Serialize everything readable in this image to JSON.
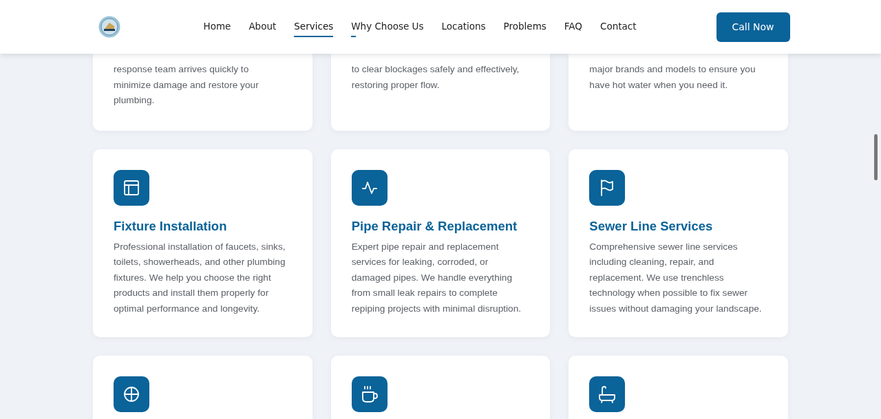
{
  "header": {
    "nav": [
      {
        "label": "Home",
        "selected": false,
        "hovered": false
      },
      {
        "label": "About",
        "selected": false,
        "hovered": false
      },
      {
        "label": "Services",
        "selected": true,
        "hovered": false
      },
      {
        "label": "Why Choose Us",
        "selected": false,
        "hovered": true
      },
      {
        "label": "Locations",
        "selected": false,
        "hovered": false
      },
      {
        "label": "Problems",
        "selected": false,
        "hovered": false
      },
      {
        "label": "FAQ",
        "selected": false,
        "hovered": false
      },
      {
        "label": "Contact",
        "selected": false,
        "hovered": false
      }
    ],
    "cta": "Call Now"
  },
  "services": [
    {
      "description": "response team arrives quickly to minimize damage and restore your plumbing."
    },
    {
      "description": "to clear blockages safely and effectively, restoring proper flow."
    },
    {
      "description": "major brands and models to ensure you have hot water when you need it."
    },
    {
      "kind": "layout",
      "title": "Fixture Installation",
      "description": "Professional installation of faucets, sinks, toilets, showerheads, and other plumbing fixtures. We help you choose the right products and install them properly for optimal performance and longevity."
    },
    {
      "kind": "activity",
      "title": "Pipe Repair & Replacement",
      "description": "Expert pipe repair and replacement services for leaking, corroded, or damaged pipes. We handle everything from small leak repairs to complete repiping projects with minimal disruption."
    },
    {
      "kind": "flag",
      "title": "Sewer Line Services",
      "description": "Comprehensive sewer line services including cleaning, repair, and replacement. We use trenchless technology when possible to fix sewer issues without damaging your landscape."
    },
    {
      "kind": "crosshair"
    },
    {
      "kind": "coffee"
    },
    {
      "kind": "bath"
    }
  ]
}
